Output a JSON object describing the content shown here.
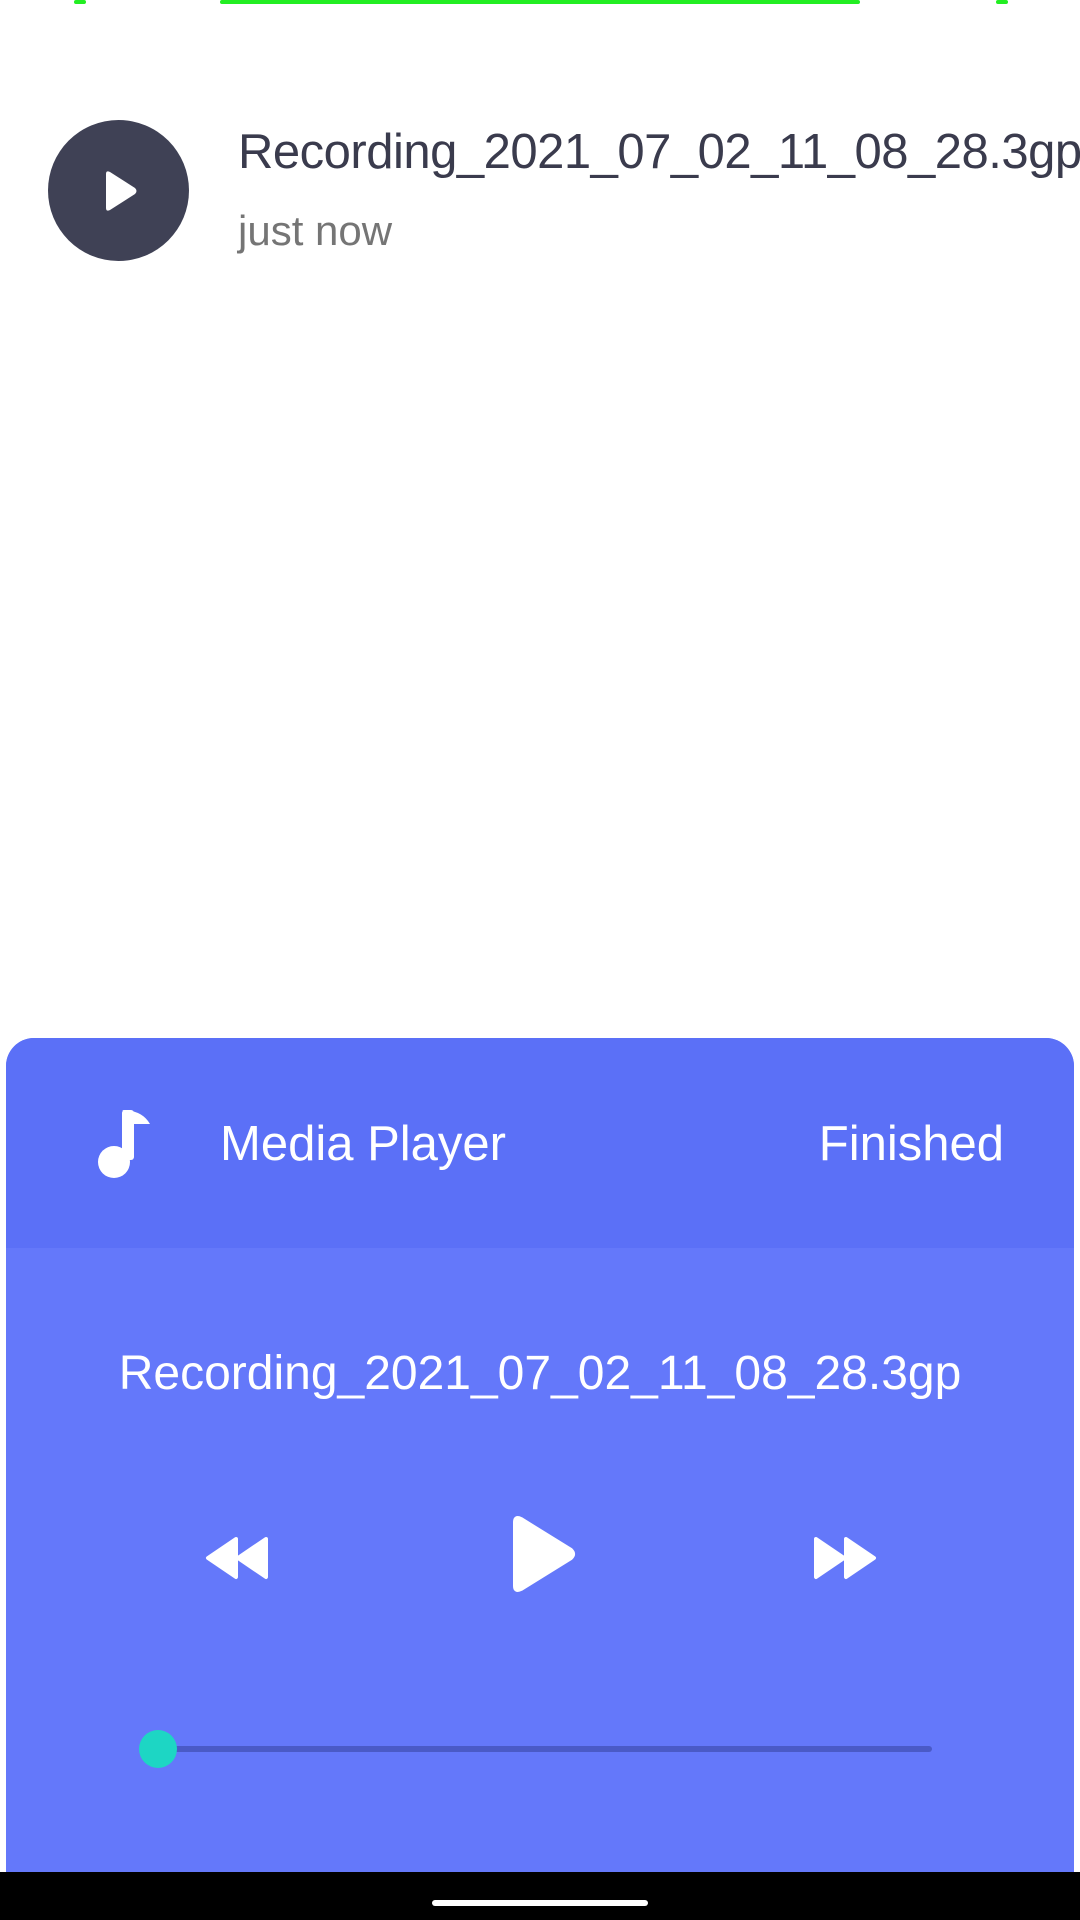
{
  "recording": {
    "title": "Recording_2021_07_02_11_08_28.3gp",
    "time": "just now",
    "play_icon": "play-icon"
  },
  "player": {
    "title": "Media Player",
    "status": "Finished",
    "track": "Recording_2021_07_02_11_08_28.3gp",
    "progress": 0,
    "icons": {
      "header": "music-note-icon",
      "rewind": "rewind-icon",
      "play": "play-icon",
      "forward": "fast-forward-icon"
    }
  },
  "colors": {
    "player_bg": "#6478fa",
    "player_header_bg": "#5b70f7",
    "seek_thumb": "#1dd6c4",
    "top_strip": "#22ee22"
  }
}
